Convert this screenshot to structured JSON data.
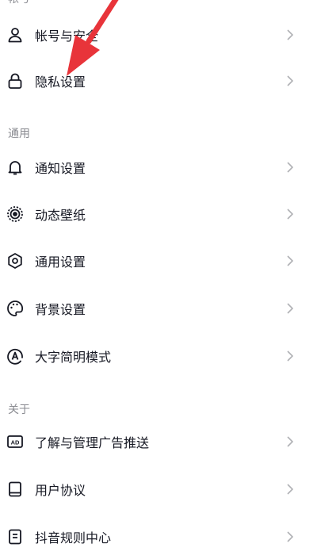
{
  "sections": {
    "account": "帐号",
    "general": "通用",
    "about": "关于"
  },
  "items": {
    "account_security": "帐号与安全",
    "privacy": "隐私设置",
    "notifications": "通知设置",
    "wallpaper": "动态壁纸",
    "general_settings": "通用设置",
    "background": "背景设置",
    "large_font": "大字简明模式",
    "ad_management": "了解与管理广告推送",
    "user_agreement": "用户协议",
    "community_rules": "抖音规则中心"
  },
  "icons": {
    "account_security": "user-icon",
    "privacy": "lock-icon",
    "notifications": "bell-icon",
    "wallpaper": "dotted-circle-icon",
    "general_settings": "gear-icon",
    "background": "palette-icon",
    "large_font": "font-a-icon",
    "ad_management": "ad-icon",
    "user_agreement": "book-icon",
    "community_rules": "document-icon"
  },
  "colors": {
    "annotation_arrow": "#e8343a",
    "section_label": "#8a8b91",
    "text": "#161823",
    "chevron": "#b0b1b5"
  }
}
